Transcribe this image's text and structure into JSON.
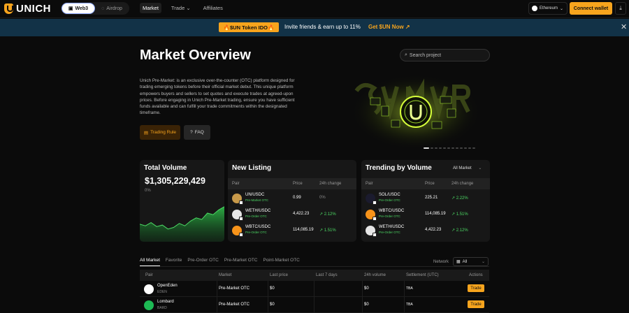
{
  "nav": {
    "brand": "UNICH",
    "seg_web3": "Web3",
    "seg_airdrop": "Airdrop",
    "links": [
      "Market",
      "Trade",
      "Affiliates"
    ],
    "network": "Ethereum",
    "connect": "Connect wallet"
  },
  "banner": {
    "ido": "🔥$UN Token IDO🔥",
    "invite": "Invite friends & earn up to 11%",
    "cta": "Get $UN Now ↗"
  },
  "hero": {
    "title": "Market Overview",
    "search_placeholder": "Search project",
    "description": "Unich Pre-Market: is an exclusive over-the-counter (OTC) platform designed for trading emerging tokens before their official market debut. This unique platform empowers buyers and sellers to set quotes and execute trades at agreed-upon prices. Before engaging in Unich Pre-Market trading, ensure you have sufficient funds available and can fulfill your trade commitments within the designated timeframe.",
    "btn_rule": "Trading Rule",
    "btn_faq": "FAQ"
  },
  "total_volume": {
    "title": "Total Volume",
    "amount": "$1,305,229,429",
    "change": "0%",
    "chart_points": [
      22,
      20,
      24,
      19,
      21,
      16,
      18,
      23,
      20,
      26,
      30,
      28,
      36,
      34,
      40,
      44
    ]
  },
  "new_listing": {
    "title": "New Listing",
    "headers": [
      "Pair",
      "Price",
      "24h change"
    ],
    "rows": [
      {
        "pair": "UN/USDC",
        "tag": "Pre-Market OTC",
        "price": "0.99",
        "change": "0%",
        "color": "#c89a4a"
      },
      {
        "pair": "WETH/USDC",
        "tag": "Pre-Order OTC",
        "price": "4,422.23",
        "change": "↗ 2.12%",
        "color": "#e6e6e6"
      },
      {
        "pair": "WBTC/USDC",
        "tag": "Pre-Order OTC",
        "price": "114,085.19",
        "change": "↗ 1.51%",
        "color": "#f7931a"
      }
    ]
  },
  "trending": {
    "title": "Trending by Volume",
    "filter": "All Market",
    "headers": [
      "Pair",
      "Price",
      "24h change"
    ],
    "rows": [
      {
        "pair": "SOL/USDC",
        "tag": "Pre-Order OTC",
        "price": "225.21",
        "change": "↗ 2.22%",
        "color": "#1b1b2e"
      },
      {
        "pair": "WBTC/USDC",
        "tag": "Pre-Order OTC",
        "price": "114,085.19",
        "change": "↗ 1.51%",
        "color": "#f7931a"
      },
      {
        "pair": "WETH/USDC",
        "tag": "Pre-Order OTC",
        "price": "4,422.23",
        "change": "↗ 2.12%",
        "color": "#e6e6e6"
      }
    ]
  },
  "market_table": {
    "tabs": [
      "All Market",
      "Favorite",
      "Pre-Order OTC",
      "Pre-Market OTC",
      "Point-Market OTC"
    ],
    "network_label": "Network",
    "network_value": "All",
    "headers": [
      "Pair",
      "Market",
      "Last price",
      "Last 7 days",
      "24h volume",
      "Settlement (UTC)",
      "Actions"
    ],
    "rows": [
      {
        "name": "OpenEden",
        "symbol": "EDEN",
        "market": "Pre-Market OTC",
        "last_price": "$0",
        "volume": "$0",
        "settlement": "TBA",
        "action": "Trade",
        "color": "#ffffff"
      },
      {
        "name": "Lombard",
        "symbol": "BARD",
        "market": "Pre-Market OTC",
        "last_price": "$0",
        "volume": "$0",
        "settlement": "TBA",
        "action": "Trade",
        "color": "#1db954"
      }
    ]
  },
  "colors": {
    "accent": "#f7a41d",
    "up": "#4cd964",
    "banner": "#123247"
  }
}
